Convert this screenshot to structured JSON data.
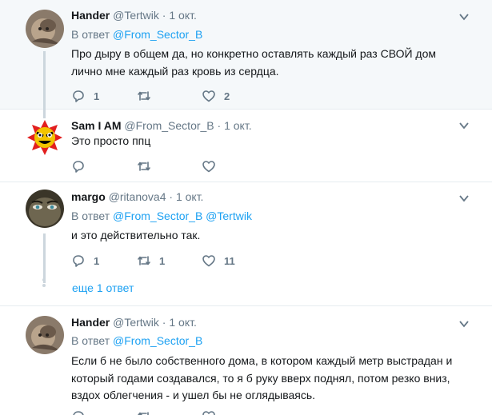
{
  "tweets": [
    {
      "name": "Hander",
      "handle": "@Tertwik",
      "time": "1 окт.",
      "reply_prefix": "В ответ",
      "reply_links": [
        "@From_Sector_B"
      ],
      "text": "Про дыру в общем да, но конкретно оставлять каждый раз СВОЙ дом лично мне каждый раз кровь из сердца.",
      "replies": "1",
      "retweets": "",
      "likes": "2"
    },
    {
      "name": "Sam I AM",
      "handle": "@From_Sector_B",
      "time": "1 окт.",
      "text": "Это просто ппц",
      "replies": "",
      "retweets": "",
      "likes": ""
    },
    {
      "name": "margo",
      "handle": "@ritanova4",
      "time": "1 окт.",
      "reply_prefix": "В ответ",
      "reply_links": [
        "@From_Sector_B",
        "@Tertwik"
      ],
      "text": "и это действительно так.",
      "replies": "1",
      "retweets": "1",
      "likes": "11"
    },
    {
      "name": "Hander",
      "handle": "@Tertwik",
      "time": "1 окт.",
      "reply_prefix": "В ответ",
      "reply_links": [
        "@From_Sector_B"
      ],
      "text": "Если б не было собственного дома, в котором каждый метр выстрадан и который годами создавался, то я б руку вверх поднял, потом резко вниз, вздох облегчения  - и ушел бы не оглядываясь."
    }
  ],
  "show_more": "еще 1 ответ",
  "colors": {
    "link": "#1da1f2",
    "muted": "#657786",
    "highlight_bg": "#f5f8fa",
    "thread": "#ccd6dd"
  },
  "icons": [
    "reply-icon",
    "retweet-icon",
    "like-icon",
    "chevron-down-icon"
  ]
}
